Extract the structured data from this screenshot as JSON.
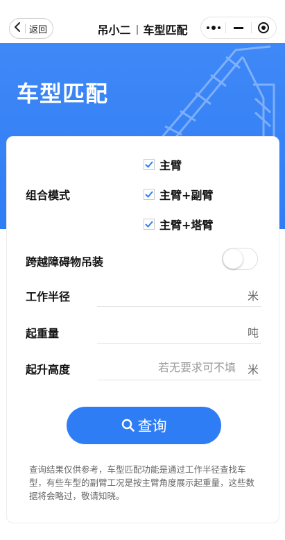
{
  "navbar": {
    "back_label": "返回",
    "title_left": "吊小二",
    "title_right": "车型匹配"
  },
  "banner": {
    "title": "车型匹配"
  },
  "form": {
    "combo_mode_label": "组合模式",
    "options": [
      {
        "label": "主臂",
        "checked": true
      },
      {
        "label": "主臂+副臂",
        "checked": true
      },
      {
        "label": "主臂+塔臂",
        "checked": true
      }
    ],
    "obstacle_label": "跨越障碍物吊装",
    "obstacle_enabled": false,
    "radius_label": "工作半径",
    "radius_value": "",
    "radius_unit": "米",
    "weight_label": "起重量",
    "weight_value": "",
    "weight_unit": "吨",
    "height_label": "起升高度",
    "height_placeholder": "若无要求可不填",
    "height_unit": "米"
  },
  "query_button": "查询",
  "note": "查询结果仅供参考，车型匹配功能是通过工作半径查找车型，有些车型的副臂工况是按主臂角度展示起重量，这些数据将会略过，敬请知晓。",
  "colors": {
    "accent": "#2f7df5",
    "banner": "#3f88f7"
  }
}
